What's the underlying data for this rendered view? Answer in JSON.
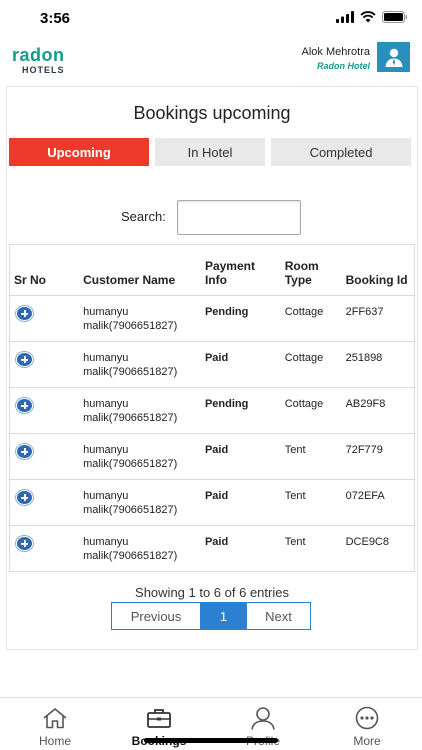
{
  "status_bar": {
    "time": "3:56"
  },
  "header": {
    "logo_main": "radon",
    "logo_sub": "HOTELS",
    "user_name": "Alok Mehrotra",
    "hotel_name": "Radon Hotel"
  },
  "page": {
    "title": "Bookings upcoming"
  },
  "tabs": [
    {
      "label": "Upcoming",
      "active": true
    },
    {
      "label": "In Hotel",
      "active": false
    },
    {
      "label": "Completed",
      "active": false
    }
  ],
  "search": {
    "label": "Search:",
    "value": ""
  },
  "table": {
    "headers": [
      "Sr No",
      "Customer Name",
      "Payment Info",
      "Room Type",
      "Booking Id"
    ],
    "rows": [
      {
        "name": "humanyu malik(7906651827)",
        "payment": "Pending",
        "room": "Cottage",
        "booking_id": "2FF637"
      },
      {
        "name": "humanyu malik(7906651827)",
        "payment": "Paid",
        "room": "Cottage",
        "booking_id": "251898"
      },
      {
        "name": "humanyu malik(7906651827)",
        "payment": "Pending",
        "room": "Cottage",
        "booking_id": "AB29F8"
      },
      {
        "name": "humanyu malik(7906651827)",
        "payment": "Paid",
        "room": "Tent",
        "booking_id": "72F779"
      },
      {
        "name": "humanyu malik(7906651827)",
        "payment": "Paid",
        "room": "Tent",
        "booking_id": "072EFA"
      },
      {
        "name": "humanyu malik(7906651827)",
        "payment": "Paid",
        "room": "Tent",
        "booking_id": "DCE9C8"
      }
    ]
  },
  "pagination": {
    "info": "Showing 1 to 6 of 6 entries",
    "previous": "Previous",
    "current": "1",
    "next": "Next"
  },
  "bottom_nav": [
    {
      "label": "Home",
      "icon": "home-icon"
    },
    {
      "label": "Bookings",
      "icon": "briefcase-icon"
    },
    {
      "label": "Profile",
      "icon": "person-icon"
    },
    {
      "label": "More",
      "icon": "more-icon"
    }
  ],
  "colors": {
    "accent": "#ee3a2d",
    "brand": "#169a8c",
    "pending": "#e02020",
    "paid": "#0d8a2e",
    "pager": "#2b80d1"
  }
}
